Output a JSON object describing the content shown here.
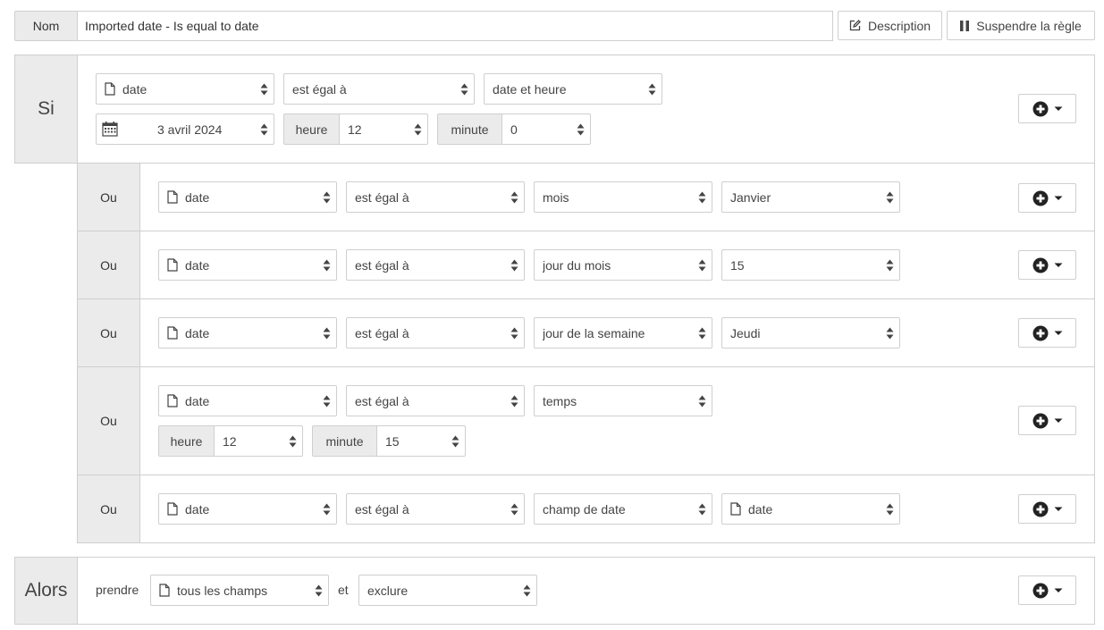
{
  "header": {
    "name_label": "Nom",
    "name_value": "Imported date - Is equal to date",
    "description_button": "Description",
    "suspend_button": "Suspendre la règle"
  },
  "if_block": {
    "label": "Si",
    "field": "date",
    "operator": "est égal à",
    "type": "date et heure",
    "date_value": "3 avril 2024",
    "hour_label": "heure",
    "hour_value": "12",
    "minute_label": "minute",
    "minute_value": "0"
  },
  "or_rows": [
    {
      "label": "Ou",
      "field": "date",
      "operator": "est égal à",
      "type": "mois",
      "value": "Janvier"
    },
    {
      "label": "Ou",
      "field": "date",
      "operator": "est égal à",
      "type": "jour du mois",
      "value": "15"
    },
    {
      "label": "Ou",
      "field": "date",
      "operator": "est égal à",
      "type": "jour de la semaine",
      "value": "Jeudi"
    },
    {
      "label": "Ou",
      "field": "date",
      "operator": "est égal à",
      "type": "temps",
      "hour_label": "heure",
      "hour_value": "12",
      "minute_label": "minute",
      "minute_value": "15"
    },
    {
      "label": "Ou",
      "field": "date",
      "operator": "est égal à",
      "type": "champ de date",
      "value": "date"
    }
  ],
  "then_block": {
    "label": "Alors",
    "take_label": "prendre",
    "fields_value": "tous les champs",
    "and_label": "et",
    "action_value": "exclure"
  },
  "icons": {
    "file": "file-icon",
    "calendar": "calendar-icon",
    "add": "plus-circle-icon",
    "caret": "caret-down-icon",
    "edit": "edit-icon",
    "pause": "pause-icon",
    "sort": "sort-arrows-icon"
  }
}
